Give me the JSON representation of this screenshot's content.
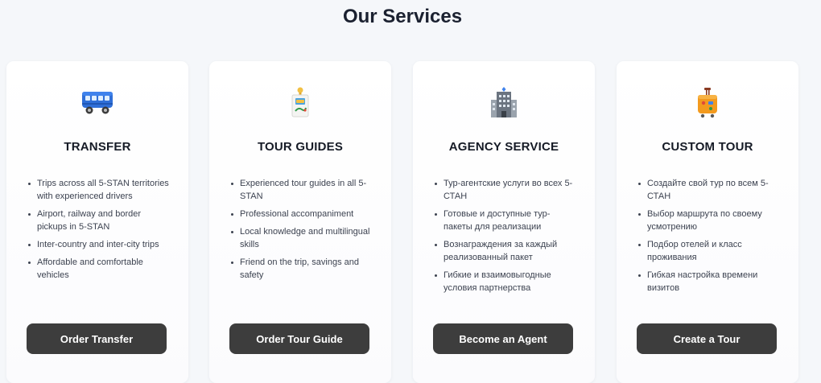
{
  "section_title": "Our Services",
  "cards": [
    {
      "icon": "bus-icon",
      "title": "TRANSFER",
      "features": [
        "Trips across all 5-STAN territories with experienced drivers",
        "Airport, railway and border pickups in 5-STAN",
        "Inter-country and inter-city trips",
        "Affordable and comfortable vehicles"
      ],
      "button": "Order Transfer"
    },
    {
      "icon": "tour-guide-icon",
      "title": "TOUR GUIDES",
      "features": [
        "Experienced tour guides in all 5-STAN",
        "Professional accompaniment",
        "Local knowledge and multilingual skills",
        "Friend on the trip, savings and safety"
      ],
      "button": "Order Tour Guide"
    },
    {
      "icon": "office-building-icon",
      "title": "AGENCY SERVICE",
      "features": [
        "Тур-агентские услуги во всех 5-СТАН",
        "Готовые и доступные тур-пакеты для реализации",
        "Вознаграждения за каждый реализованный пакет",
        "Гибкие и взаимовыгодные условия партнерства"
      ],
      "button": "Become an Agent"
    },
    {
      "icon": "luggage-icon",
      "title": "CUSTOM TOUR",
      "features": [
        "Создайте свой тур по всем 5-СТАН",
        "Выбор маршрута по своему усмотрению",
        "Подбор отелей и класс проживания",
        "Гибкая настройка времени визитов"
      ],
      "button": "Create a Tour"
    }
  ]
}
